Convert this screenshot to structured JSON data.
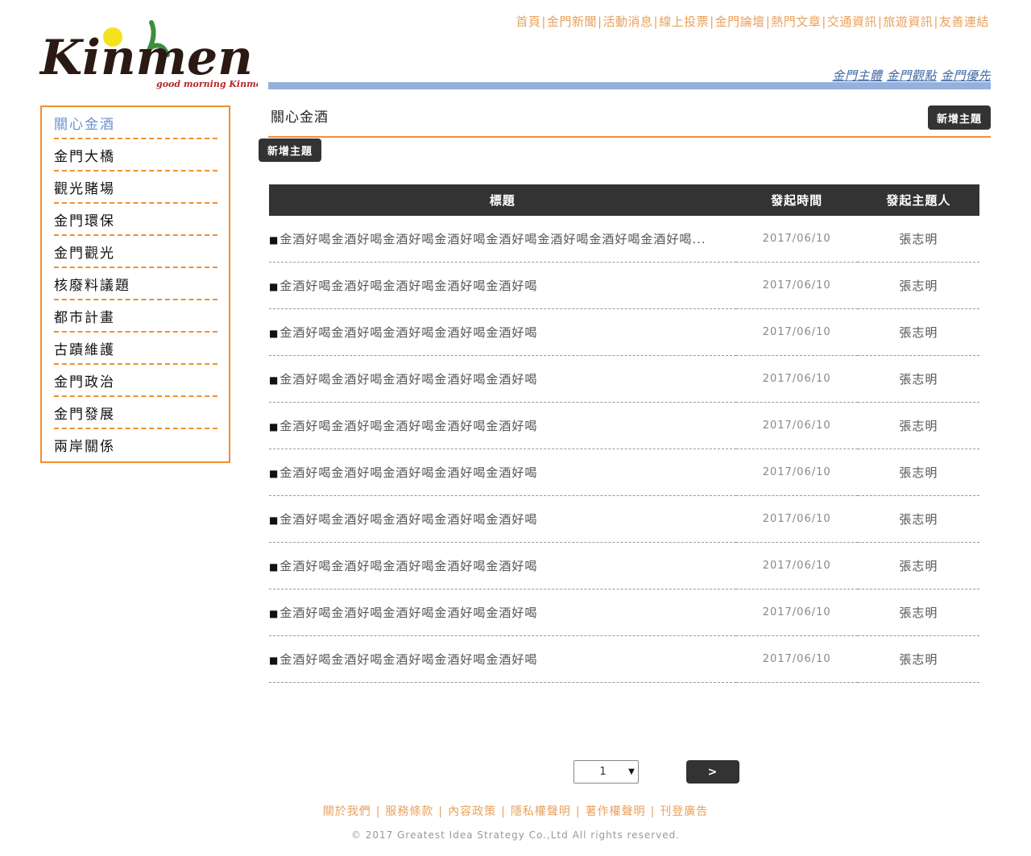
{
  "logo": {
    "main_text": "Kinmen",
    "tagline": "good morning Kinmen"
  },
  "top_nav": [
    "首頁",
    "金門新聞",
    "活動消息",
    "線上投票",
    "金門論壇",
    "熱門文章",
    "交通資訊",
    "旅遊資訊",
    "友善連結"
  ],
  "slogans": [
    "金門主體",
    "金門觀點",
    "金門優先"
  ],
  "sidebar": {
    "items": [
      "關心金酒",
      "金門大橋",
      "觀光賭場",
      "金門環保",
      "金門觀光",
      "核廢料議題",
      "都市計畫",
      "古蹟維護",
      "金門政治",
      "金門發展",
      "兩岸關係"
    ],
    "active_index": 0
  },
  "main": {
    "title": "關心金酒",
    "new_topic_label": "新增主題",
    "new_topic_label_2": "新增主題",
    "table": {
      "headers": {
        "title": "標題",
        "date": "發起時間",
        "author": "發起主題人"
      },
      "rows": [
        {
          "title": "金酒好喝金酒好喝金酒好喝金酒好喝金酒好喝金酒好喝金酒好喝金酒好喝...",
          "date": "2017/06/10",
          "author": "張志明"
        },
        {
          "title": "金酒好喝金酒好喝金酒好喝金酒好喝金酒好喝",
          "date": "2017/06/10",
          "author": "張志明"
        },
        {
          "title": "金酒好喝金酒好喝金酒好喝金酒好喝金酒好喝",
          "date": "2017/06/10",
          "author": "張志明"
        },
        {
          "title": "金酒好喝金酒好喝金酒好喝金酒好喝金酒好喝",
          "date": "2017/06/10",
          "author": "張志明"
        },
        {
          "title": "金酒好喝金酒好喝金酒好喝金酒好喝金酒好喝",
          "date": "2017/06/10",
          "author": "張志明"
        },
        {
          "title": "金酒好喝金酒好喝金酒好喝金酒好喝金酒好喝",
          "date": "2017/06/10",
          "author": "張志明"
        },
        {
          "title": "金酒好喝金酒好喝金酒好喝金酒好喝金酒好喝",
          "date": "2017/06/10",
          "author": "張志明"
        },
        {
          "title": "金酒好喝金酒好喝金酒好喝金酒好喝金酒好喝",
          "date": "2017/06/10",
          "author": "張志明"
        },
        {
          "title": "金酒好喝金酒好喝金酒好喝金酒好喝金酒好喝",
          "date": "2017/06/10",
          "author": "張志明"
        },
        {
          "title": "金酒好喝金酒好喝金酒好喝金酒好喝金酒好喝",
          "date": "2017/06/10",
          "author": "張志明"
        }
      ]
    }
  },
  "pagination": {
    "current_page": "1",
    "next_label": ">"
  },
  "footer": {
    "links": [
      "關於我們",
      "服務條款",
      "內容政策",
      "隱私權聲明",
      "著作權聲明",
      "刊登廣告"
    ],
    "copyright": "© 2017 Greatest Idea Strategy Co.,Ltd All rights reserved."
  },
  "colors": {
    "accent_orange": "#ef8f2f",
    "nav_orange": "#e8a15c",
    "slogan_blue": "#3f6aa8",
    "bar_blue": "#95b1db",
    "active_blue": "#6d8fcc",
    "dark": "#333333"
  }
}
